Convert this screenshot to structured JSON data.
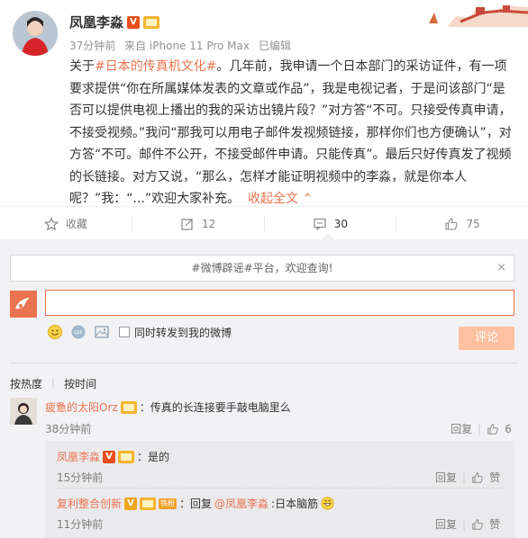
{
  "post": {
    "author": "凤凰李淼",
    "time": "37分钟前",
    "source": "来自 iPhone 11 Pro Max",
    "edited": "已编辑",
    "content_pre": "关于",
    "hashtag": "#日本的传真机文化#",
    "content_body": "。几年前，我申请一个日本部门的采访证件，有一项要求提供“你在所属媒体发表的文章或作品”，我是电视记者，于是问该部门“是否可以提供电视上播出的我的采访出镜片段？”对方答“不可。只接受传真申请，不接受视频。”我问“那我可以用电子邮件发视频链接，那样你们也方便确认”，对方答“不可。邮件不公开，不接受邮件申请。只能传真”。最后只好传真发了视频的长链接。对方又说，“那么，怎样才能证明视频中的李淼，就是你本人呢？”我：“...”欢迎大家补充。",
    "expand_label": "收起全文",
    "vip_badge": "V"
  },
  "actions": {
    "favorite_label": "收藏",
    "repost_count": "12",
    "comment_count": "30",
    "like_count": "75"
  },
  "comment_area": {
    "notice": "#微博辟谣#平台，欢迎查询!",
    "close_symbol": "×",
    "repost_checkbox_label": "同时转发到我的微博",
    "submit_label": "评论",
    "sort_hot": "按热度",
    "sort_time": "按时间"
  },
  "comments": [
    {
      "user": "疲惫的太阳Orz",
      "text": "：传真的长连接要手敲电脑里么",
      "time": "38分钟前",
      "reply_label": "回复",
      "likes": "6",
      "replies": [
        {
          "user": "凤凰李淼",
          "text": "：是的",
          "time": "15分钟前",
          "reply_label": "回复",
          "like_label": "赞"
        },
        {
          "user": "复利整合创新",
          "badge": "铁粉",
          "text_prefix": "：回复",
          "mention": "@凤凰李淼",
          "text": ":日本脑筋",
          "time": "11分钟前",
          "reply_label": "回复",
          "like_label": "赞"
        }
      ]
    }
  ],
  "colors": {
    "accent": "#eb7350",
    "comment_bg": "#f2f2f5",
    "reply_bg": "#eaeaec"
  }
}
